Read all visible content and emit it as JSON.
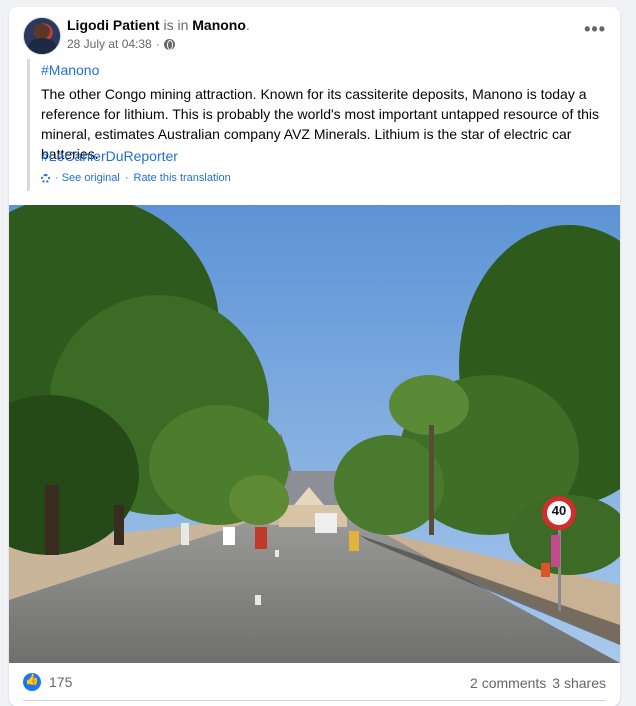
{
  "post": {
    "author": "Ligodi Patient",
    "action": "is in",
    "place": "Manono",
    "period": ".",
    "date": "28 July at 04:38",
    "separator": "·",
    "more": "•••"
  },
  "text": {
    "hashtag1": "#Manono",
    "body": "The other Congo mining attraction. Known for its cassiterite deposits, Manono is today a reference for lithium. This is probably the world's most important untapped resource of this mineral, estimates Australian company AVZ Minerals. Lithium is the star of electric car batteries.",
    "hashtag2": "#LeCahierDuReporter"
  },
  "translation": {
    "see_original": "· See original",
    "dot": "·",
    "rate": "Rate this translation"
  },
  "photo": {
    "sign_text": "40"
  },
  "footer": {
    "likes": "175",
    "comments": "2 comments",
    "shares": "3 shares"
  },
  "colors": {
    "link": "#216fdb",
    "like": "#1877f2"
  },
  "icons": [
    "globe-icon",
    "more-options-icon",
    "gear-icon",
    "like-icon"
  ]
}
